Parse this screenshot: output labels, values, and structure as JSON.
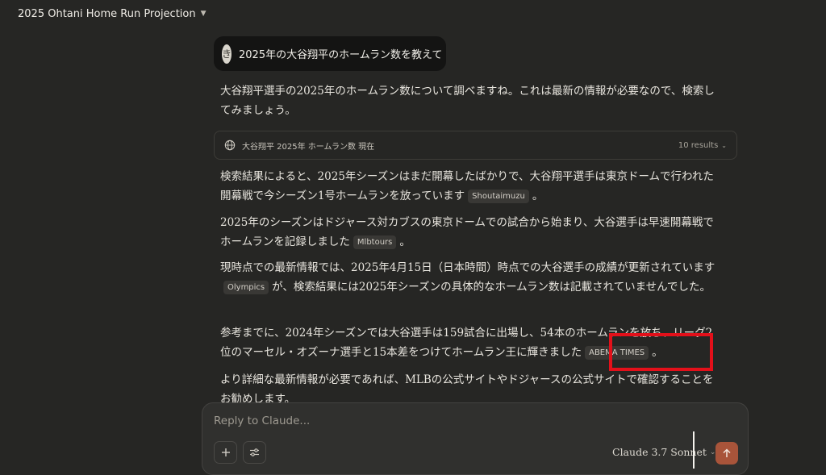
{
  "header": {
    "title": "2025 Ohtani Home Run Projection"
  },
  "user_message": {
    "avatar_initial": "き",
    "text": "2025年の大谷翔平のホームラン数を教えて"
  },
  "answer": {
    "intro": "大谷翔平選手の2025年のホームラン数について調べますね。これは最新の情報が必要なので、検索してみましょう。",
    "search": {
      "query": "大谷翔平 2025年 ホームラン数 現在",
      "results": "10 results"
    },
    "p2_text": "検索結果によると、2025年シーズンはまだ開幕したばかりで、大谷翔平選手は東京ドームで行われた開幕戦で今シーズン1号ホームランを放っています",
    "p2_cite": "Shoutaimuzu",
    "p3_text": "2025年のシーズンはドジャース対カブスの東京ドームでの試合から始まり、大谷選手は早速開幕戦でホームランを記録しました",
    "p3_cite": "Mlbtours",
    "p4_text_a": "現時点での最新情報では、2025年4月15日（日本時間）時点での大谷選手の成績が更新されています",
    "p4_cite": "Olympics",
    "p4_text_b": "が、検索結果には2025年シーズンの具体的なホームラン数は記載されていませんでした。",
    "p5_text": "参考までに、2024年シーズンでは大谷選手は159試合に出場し、54本のホームランを放ち、リーグ2位のマーセル・オズーナ選手と15本差をつけてホームラン王に輝きました",
    "p5_cite": "ABEMA TIMES",
    "p6_text": "より詳細な最新情報が必要であれば、MLBの公式サイトやドジャースの公式サイトで確認することをお勧めします。",
    "period": "。"
  },
  "composer": {
    "placeholder": "Reply to Claude...",
    "model": "Claude 3.7 Sonnet"
  },
  "icons": {
    "title_chevron": "chevron-down-icon",
    "search": "globe-icon",
    "add": "plus-icon",
    "tools": "sliders-icon",
    "send": "arrow-up-icon"
  },
  "colors": {
    "background": "#262624",
    "send_button": "#a8543a",
    "highlight": "#e3101a"
  }
}
